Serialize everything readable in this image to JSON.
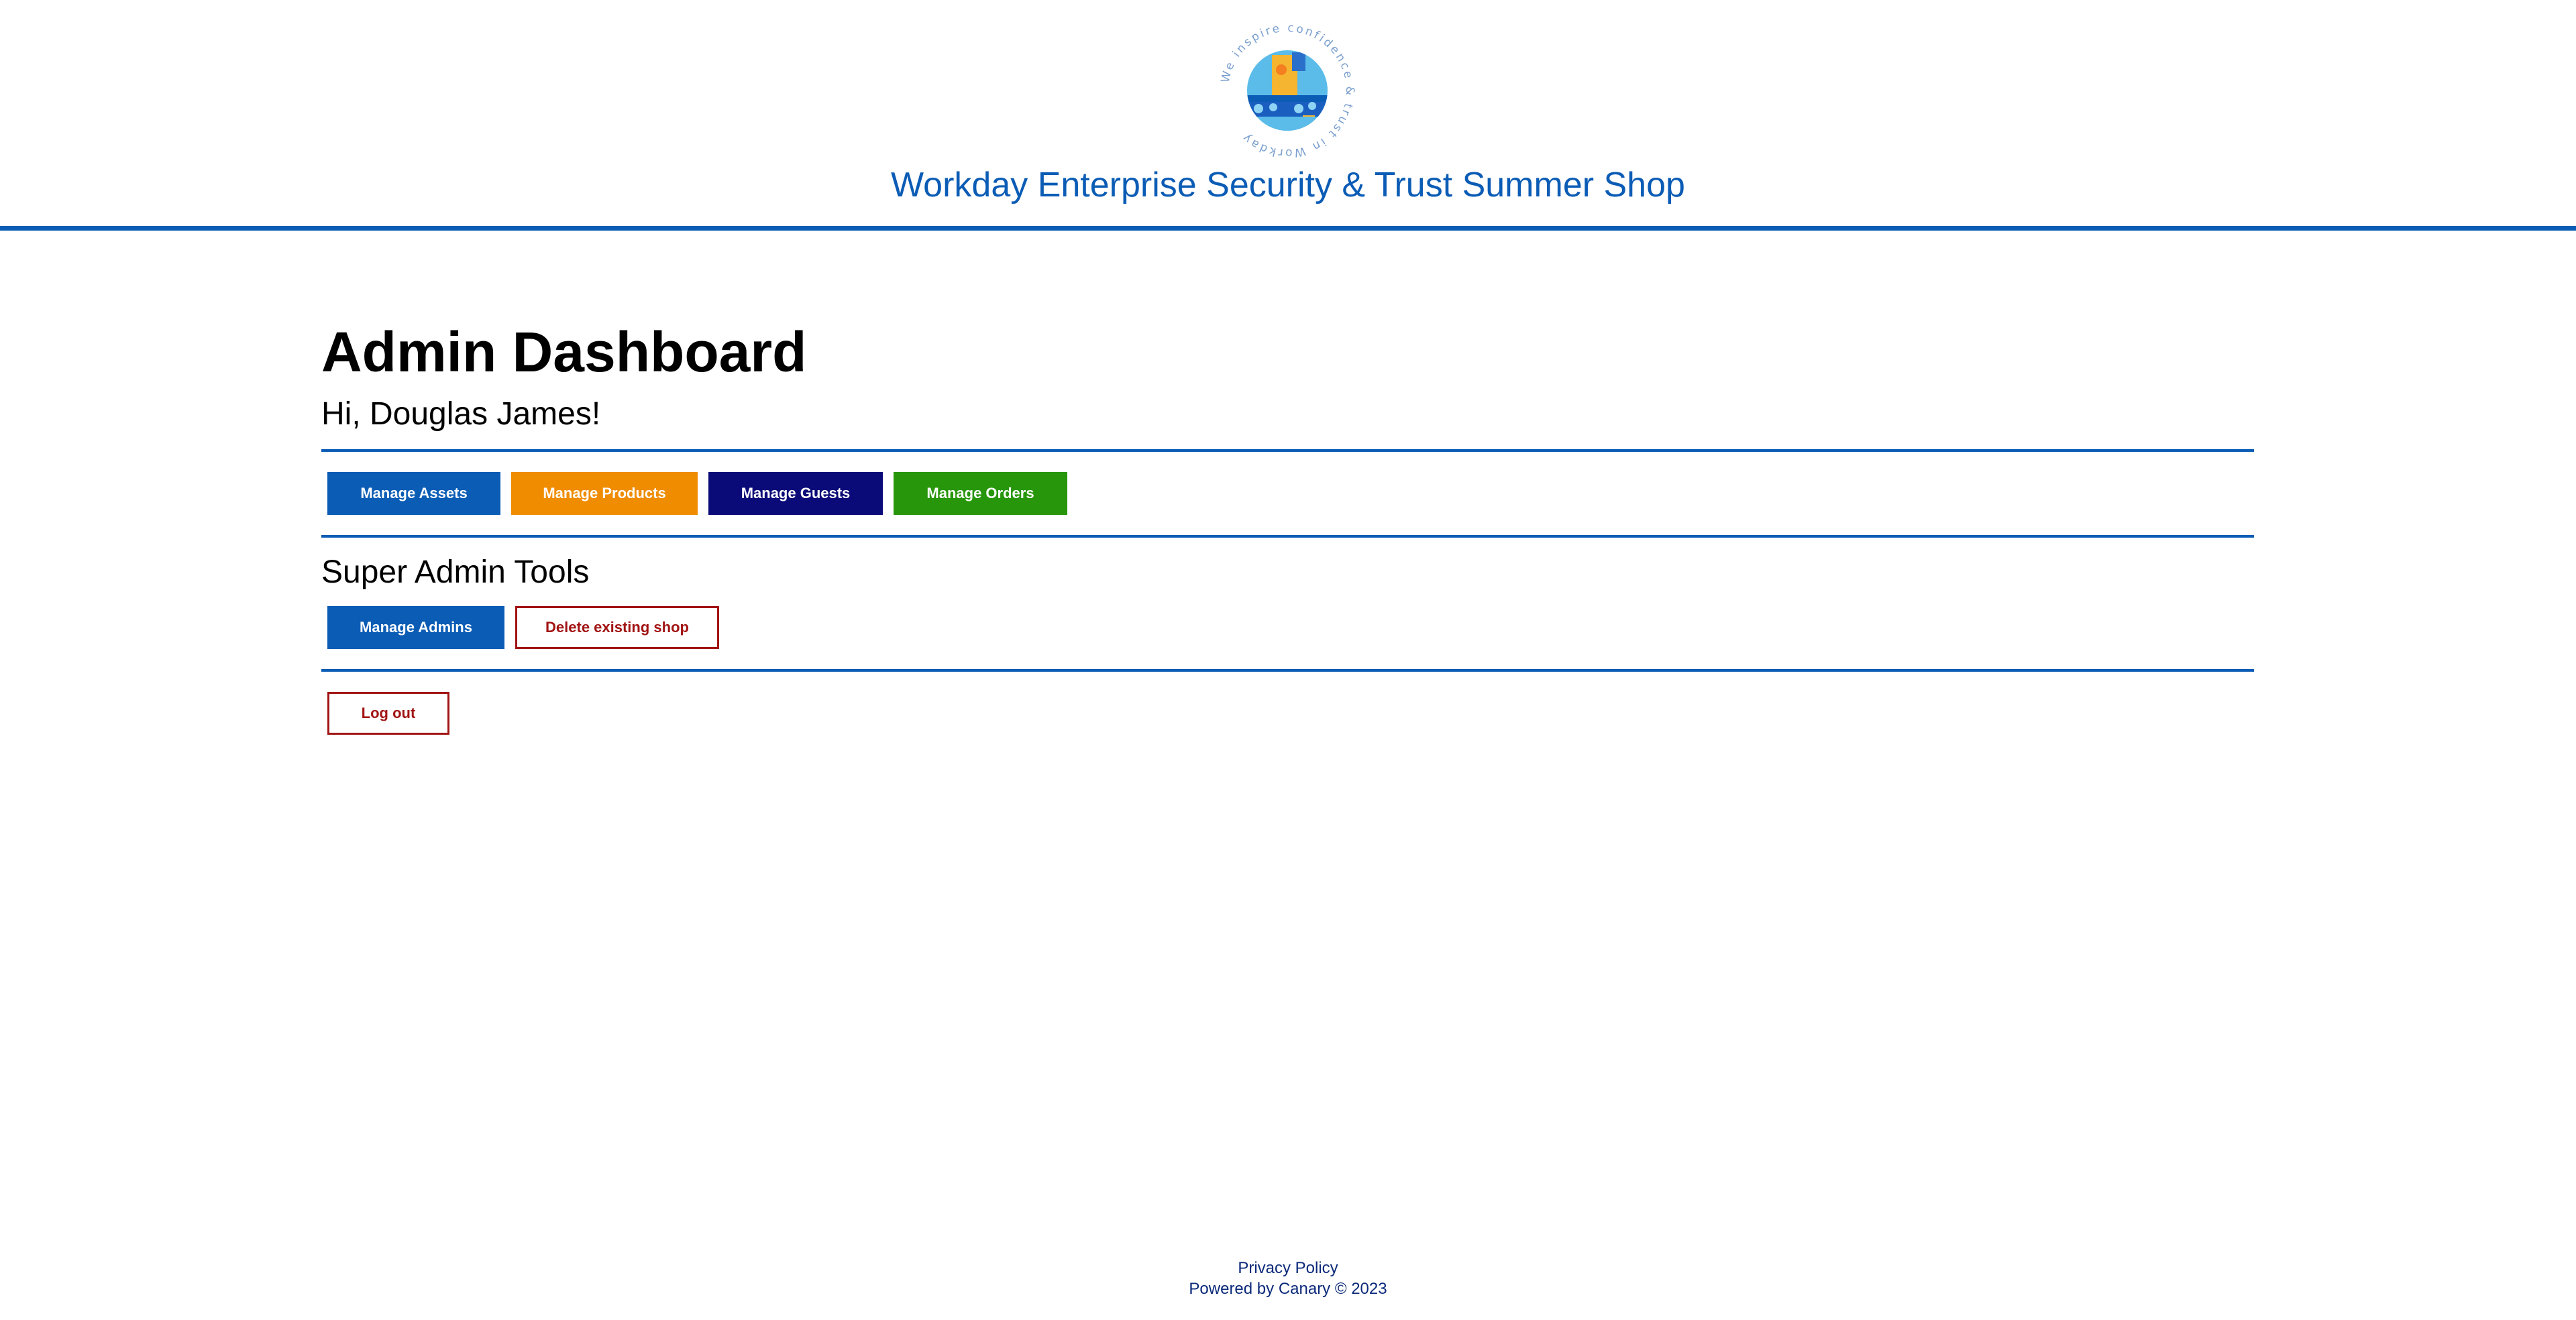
{
  "header": {
    "logo_ring_text": "We inspire confidence & trust in Workday",
    "site_title": "Workday Enterprise Security & Trust Summer Shop",
    "brand_color": "#0b5cb5"
  },
  "main": {
    "page_title": "Admin Dashboard",
    "greeting": "Hi, Douglas James!",
    "manage_buttons": [
      {
        "label": "Manage Assets",
        "color": "#0b5cb5"
      },
      {
        "label": "Manage Products",
        "color": "#f08c00"
      },
      {
        "label": "Manage Guests",
        "color": "#0a0a78"
      },
      {
        "label": "Manage Orders",
        "color": "#28960a"
      }
    ],
    "super_admin": {
      "title": "Super Admin Tools",
      "manage_admins_label": "Manage Admins",
      "delete_shop_label": "Delete existing shop"
    },
    "logout_label": "Log out"
  },
  "footer": {
    "privacy_label": "Privacy Policy",
    "powered_by": "Powered by Canary © 2023"
  }
}
